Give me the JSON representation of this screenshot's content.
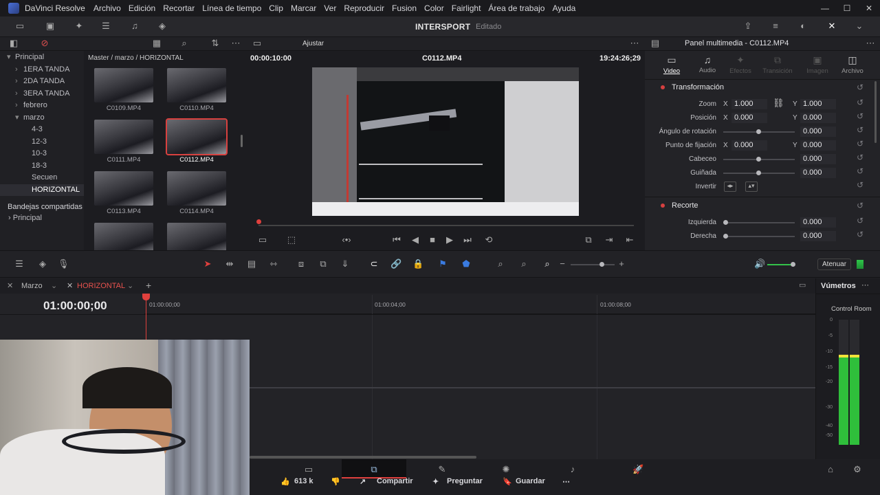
{
  "app": {
    "title": "DaVinci Resolve",
    "menu": [
      "Archivo",
      "Edición",
      "Recortar",
      "Línea de tiempo",
      "Clip",
      "Marcar",
      "Ver",
      "Reproducir",
      "Fusion",
      "Color",
      "Fairlight",
      "Área de trabajo",
      "Ayuda"
    ]
  },
  "project": {
    "name": "INTERSPORT",
    "status": "Editado"
  },
  "media": {
    "breadcrumb": "Master / marzo / HORIZONTAL",
    "fit": "Ajustar",
    "bins": [
      {
        "label": "Principal",
        "indent": 0,
        "arrow": "▾"
      },
      {
        "label": "1ERA TANDA",
        "indent": 1,
        "arrow": "›"
      },
      {
        "label": "2DA TANDA",
        "indent": 1,
        "arrow": "›"
      },
      {
        "label": "3ERA TANDA",
        "indent": 1,
        "arrow": "›"
      },
      {
        "label": "febrero",
        "indent": 1,
        "arrow": "›"
      },
      {
        "label": "marzo",
        "indent": 1,
        "arrow": "▾"
      },
      {
        "label": "4-3",
        "indent": 2,
        "arrow": ""
      },
      {
        "label": "12-3",
        "indent": 2,
        "arrow": ""
      },
      {
        "label": "10-3",
        "indent": 2,
        "arrow": ""
      },
      {
        "label": "18-3",
        "indent": 2,
        "arrow": ""
      },
      {
        "label": "Secuen",
        "indent": 2,
        "arrow": ""
      },
      {
        "label": "HORIZONTAL",
        "indent": 2,
        "arrow": "",
        "selected": true
      }
    ],
    "shared": {
      "title": "Bandejas compartidas",
      "item": "Principal"
    },
    "clips": [
      {
        "label": "C0109.MP4"
      },
      {
        "label": "C0110.MP4"
      },
      {
        "label": "C0111.MP4"
      },
      {
        "label": "C0112.MP4",
        "selected": true
      },
      {
        "label": "C0113.MP4"
      },
      {
        "label": "C0114.MP4"
      },
      {
        "label": ""
      },
      {
        "label": ""
      }
    ]
  },
  "viewer": {
    "timecode_left": "00:00:10:00",
    "clip": "C0112.MP4",
    "timecode_right": "19:24:26;29"
  },
  "inspector": {
    "title": "Panel multimedia - C0112.MP4",
    "tabs": [
      "Video",
      "Audio",
      "Efectos",
      "Transición",
      "Imagen",
      "Archivo"
    ],
    "transform_title": "Transformación",
    "zoom": {
      "label": "Zoom",
      "x": "1.000",
      "y": "1.000"
    },
    "position": {
      "label": "Posición",
      "x": "0.000",
      "y": "0.000"
    },
    "rotation": {
      "label": "Ángulo de rotación",
      "value": "0.000"
    },
    "anchor": {
      "label": "Punto de fijación",
      "x": "0.000",
      "y": "0.000"
    },
    "pitch": {
      "label": "Cabeceo",
      "value": "0.000"
    },
    "yaw": {
      "label": "Guiñada",
      "value": "0.000"
    },
    "flip": {
      "label": "Invertir"
    },
    "crop_title": "Recorte",
    "crop_left": {
      "label": "Izquierda",
      "value": "0.000"
    },
    "crop_right": {
      "label": "Derecha",
      "value": "0.000"
    },
    "xlab": "X",
    "ylab": "Y"
  },
  "toolbar2": {
    "dim": "Atenuar"
  },
  "timeline": {
    "tabs": [
      "Marzo",
      "HORIZONTAL"
    ],
    "timecode": "01:00:00;00",
    "ruler": [
      "01:00:00;00",
      "01:00:04;00",
      "01:00:08;00"
    ]
  },
  "vumeter": {
    "title": "Vúmetros",
    "room": "Control Room",
    "scale": [
      "0",
      "-5",
      "-10",
      "-15",
      "-20",
      "-30",
      "-40",
      "-50"
    ],
    "level": 0.72
  },
  "overlay": {
    "likes": "613 k",
    "share": "Compartir",
    "ask": "Preguntar",
    "save": "Guardar"
  }
}
